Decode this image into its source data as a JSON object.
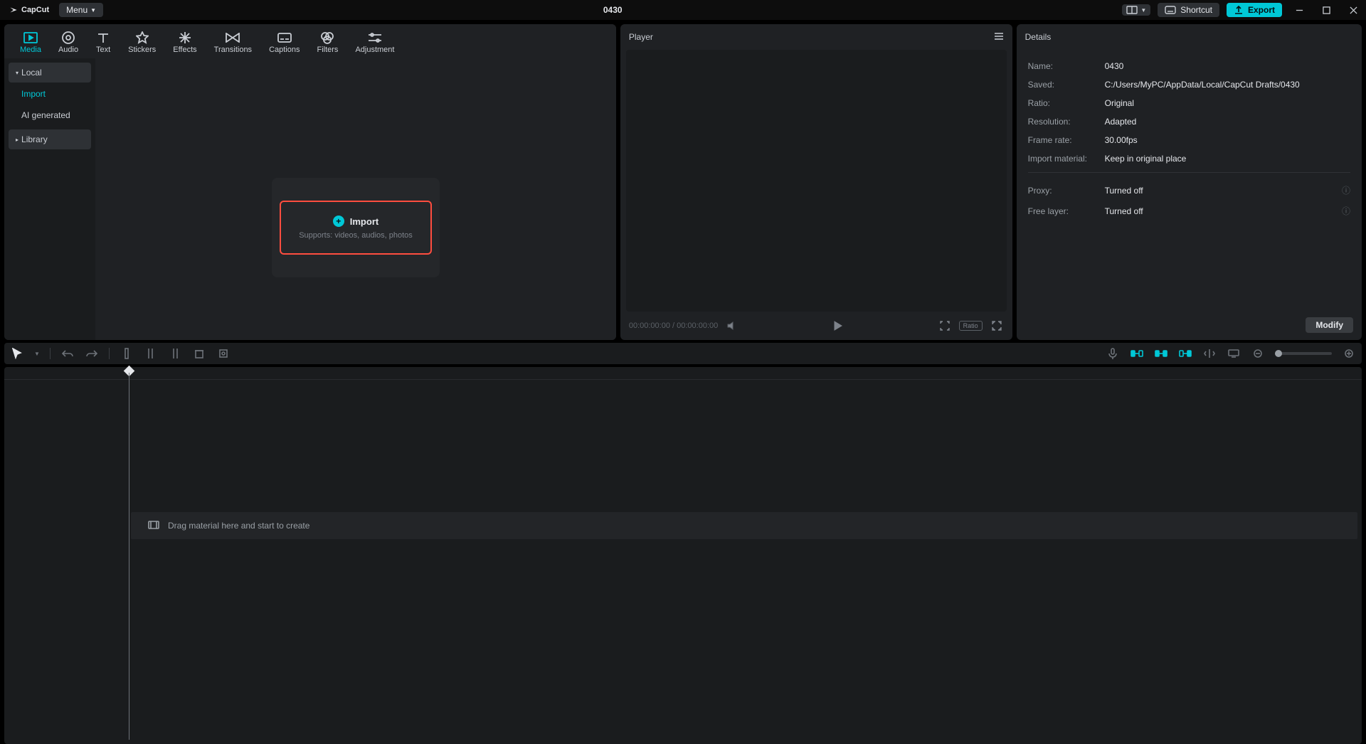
{
  "app": {
    "brand": "CapCut",
    "menu": "Menu",
    "title": "0430",
    "shortcut": "Shortcut",
    "export": "Export"
  },
  "tabs": [
    "Media",
    "Audio",
    "Text",
    "Stickers",
    "Effects",
    "Transitions",
    "Captions",
    "Filters",
    "Adjustment"
  ],
  "side": {
    "local": "Local",
    "import": "Import",
    "ai": "AI generated",
    "library": "Library"
  },
  "importBox": {
    "label": "Import",
    "sub": "Supports: videos, audios, photos"
  },
  "player": {
    "head": "Player",
    "time": "00:00:00:00 / 00:00:00:00",
    "ratio": "Ratio"
  },
  "details": {
    "head": "Details",
    "rows": {
      "name": {
        "l": "Name:",
        "v": "0430"
      },
      "saved": {
        "l": "Saved:",
        "v": "C:/Users/MyPC/AppData/Local/CapCut Drafts/0430"
      },
      "ratio": {
        "l": "Ratio:",
        "v": "Original"
      },
      "res": {
        "l": "Resolution:",
        "v": "Adapted"
      },
      "fps": {
        "l": "Frame rate:",
        "v": "30.00fps"
      },
      "impmat": {
        "l": "Import material:",
        "v": "Keep in original place"
      },
      "proxy": {
        "l": "Proxy:",
        "v": "Turned off"
      },
      "flayer": {
        "l": "Free layer:",
        "v": "Turned off"
      }
    },
    "modify": "Modify"
  },
  "timeline": {
    "drop": "Drag material here and start to create"
  }
}
